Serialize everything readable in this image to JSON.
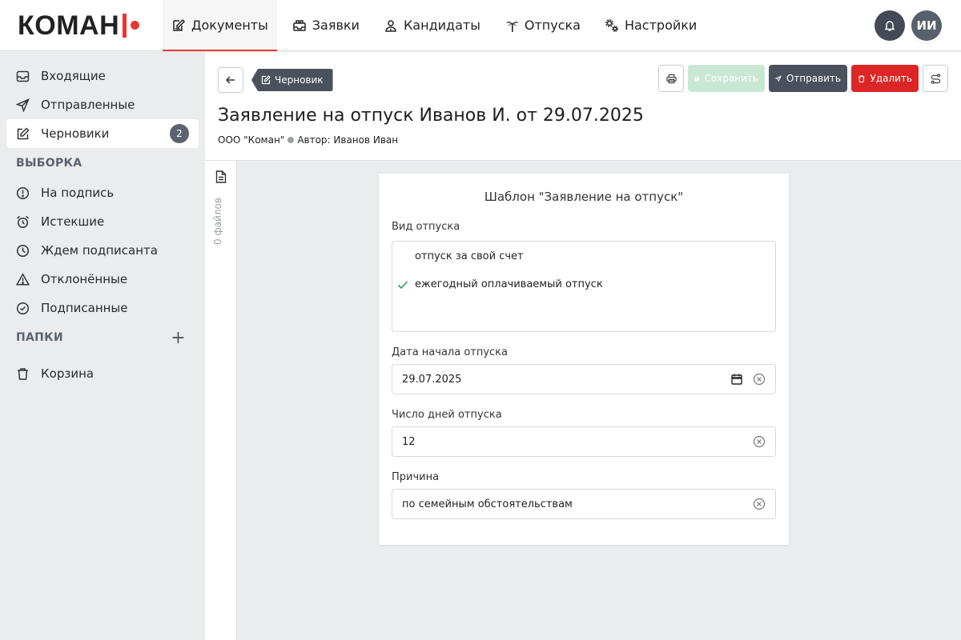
{
  "brand": {
    "logo_text": "КОМАН"
  },
  "nav": {
    "items": [
      {
        "label": "Документы",
        "icon": "document-edit-icon"
      },
      {
        "label": "Заявки",
        "icon": "inbox-tray-icon"
      },
      {
        "label": "Кандидаты",
        "icon": "person-badge-icon"
      },
      {
        "label": "Отпуска",
        "icon": "palm-tree-icon"
      },
      {
        "label": "Настройки",
        "icon": "gears-icon"
      }
    ]
  },
  "user": {
    "initials": "ИИ"
  },
  "sidebar": {
    "main": [
      {
        "label": "Входящие",
        "icon": "inbox-icon"
      },
      {
        "label": "Отправленные",
        "icon": "send-icon"
      },
      {
        "label": "Черновики",
        "icon": "draft-icon",
        "badge": "2"
      }
    ],
    "selection_header": "ВЫБОРКА",
    "selection": [
      {
        "label": "На подпись",
        "icon": "alert-circle-icon"
      },
      {
        "label": "Истекшие",
        "icon": "alarm-clock-icon"
      },
      {
        "label": "Ждем подписанта",
        "icon": "clock-icon"
      },
      {
        "label": "Отклонённые",
        "icon": "warning-triangle-icon"
      },
      {
        "label": "Подписанные",
        "icon": "check-circle-icon"
      }
    ],
    "folders_header": "ПАПКИ",
    "folders_add": "+",
    "trash": {
      "label": "Корзина",
      "icon": "trash-icon"
    }
  },
  "document": {
    "status_tag": "Черновик",
    "title": "Заявление на отпуск Иванов И. от 29.07.2025",
    "organization": "ООО \"Коман\"",
    "author": "Автор: Иванов Иван",
    "actions": {
      "save": "Сохранить",
      "send": "Отправить",
      "delete": "Удалить"
    },
    "files_label": "0 файлов"
  },
  "form": {
    "title": "Шаблон \"Заявление на отпуск\"",
    "leave_type": {
      "label": "Вид отпуска",
      "options": [
        {
          "label": "отпуск за свой счет",
          "selected": false
        },
        {
          "label": "ежегодный оплачиваемый отпуск",
          "selected": true
        }
      ]
    },
    "start_date": {
      "label": "Дата начала отпуска",
      "value": "29.07.2025"
    },
    "days": {
      "label": "Число дней отпуска",
      "value": "12"
    },
    "reason": {
      "label": "Причина",
      "value": "по семейным обстоятельствам"
    }
  },
  "colors": {
    "accent_red": "#e53935",
    "dark": "#4a515c",
    "danger": "#dc2626",
    "save_disabled": "#c9e8d3",
    "check_green": "#2e9d57"
  }
}
